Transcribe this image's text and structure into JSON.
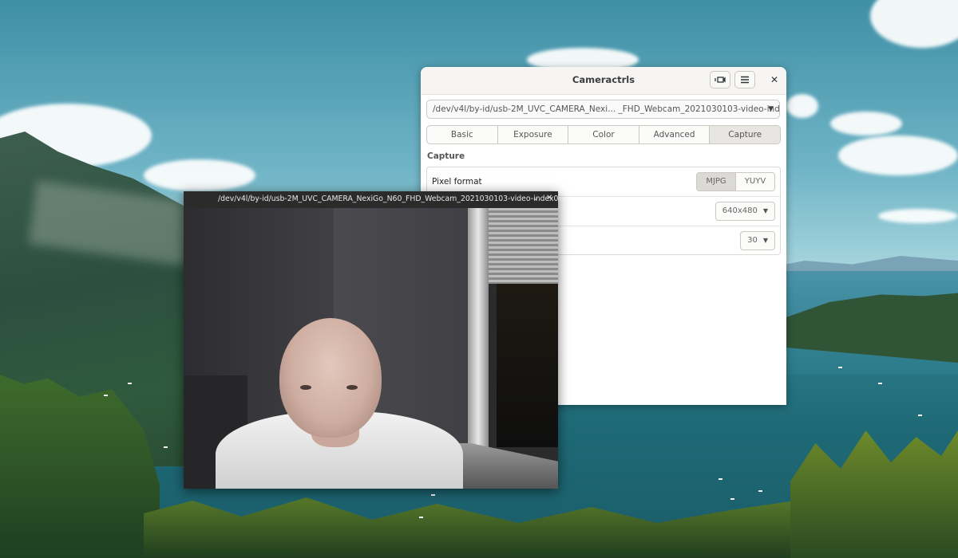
{
  "main_window": {
    "title": "Cameractrls",
    "icons": [
      "camera-switch-icon",
      "hamburger-menu-icon",
      "close-icon"
    ],
    "device": "/dev/v4l/by-id/usb-2M_UVC_CAMERA_Nexi... _FHD_Webcam_2021030103-video-index0",
    "tabs": [
      {
        "label": "Basic",
        "active": false
      },
      {
        "label": "Exposure",
        "active": false
      },
      {
        "label": "Color",
        "active": false
      },
      {
        "label": "Advanced",
        "active": false
      },
      {
        "label": "Capture",
        "active": true
      }
    ],
    "section_title": "Capture",
    "pixel_format": {
      "label": "Pixel format",
      "options": [
        "MJPG",
        "YUYV"
      ],
      "selected": "MJPG"
    },
    "resolution": {
      "value": "640x480"
    },
    "fps": {
      "value": "30"
    }
  },
  "video_window": {
    "title": "/dev/v4l/by-id/usb-2M_UVC_CAMERA_NexiGo_N60_FHD_Webcam_2021030103-video-index0",
    "icons": [
      "chevron-down-icon",
      "close-icon"
    ]
  },
  "colors": {
    "header_bg": "#f6f5f4",
    "active_tab": "#e8e6e3",
    "video_titlebar": "#2b2b2b"
  }
}
